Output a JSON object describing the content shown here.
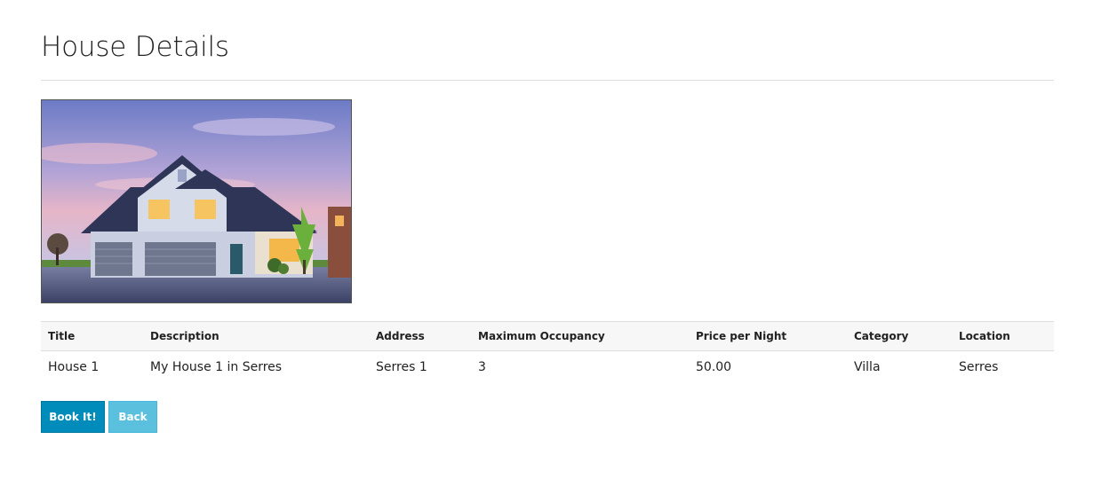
{
  "page": {
    "title": "House Details"
  },
  "photo": {
    "alt": "House photo",
    "icon": "house-photo"
  },
  "table": {
    "headers": [
      "Title",
      "Description",
      "Address",
      "Maximum Occupancy",
      "Price per Night",
      "Category",
      "Location"
    ],
    "rows": [
      [
        "House 1",
        "My House 1 in Serres",
        "Serres 1",
        "3",
        "50.00",
        "Villa",
        "Serres"
      ]
    ]
  },
  "actions": {
    "book_label": "Book It!",
    "back_label": "Back"
  },
  "colors": {
    "primary": "#008cba",
    "info": "#5bc0de"
  }
}
